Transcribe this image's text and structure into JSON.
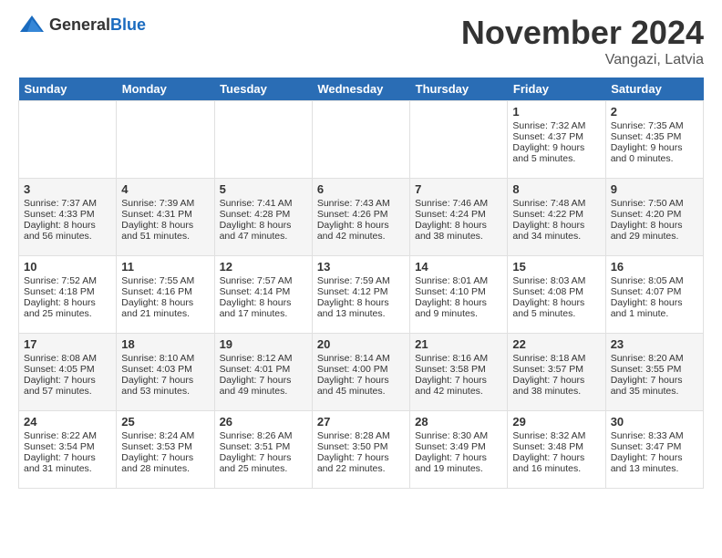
{
  "header": {
    "logo_general": "General",
    "logo_blue": "Blue",
    "month_title": "November 2024",
    "location": "Vangazi, Latvia"
  },
  "days_of_week": [
    "Sunday",
    "Monday",
    "Tuesday",
    "Wednesday",
    "Thursday",
    "Friday",
    "Saturday"
  ],
  "weeks": [
    [
      {
        "day": "",
        "sunrise": "",
        "sunset": "",
        "daylight": "",
        "empty": true
      },
      {
        "day": "",
        "sunrise": "",
        "sunset": "",
        "daylight": "",
        "empty": true
      },
      {
        "day": "",
        "sunrise": "",
        "sunset": "",
        "daylight": "",
        "empty": true
      },
      {
        "day": "",
        "sunrise": "",
        "sunset": "",
        "daylight": "",
        "empty": true
      },
      {
        "day": "",
        "sunrise": "",
        "sunset": "",
        "daylight": "",
        "empty": true
      },
      {
        "day": "1",
        "sunrise": "Sunrise: 7:32 AM",
        "sunset": "Sunset: 4:37 PM",
        "daylight": "Daylight: 9 hours and 5 minutes."
      },
      {
        "day": "2",
        "sunrise": "Sunrise: 7:35 AM",
        "sunset": "Sunset: 4:35 PM",
        "daylight": "Daylight: 9 hours and 0 minutes."
      }
    ],
    [
      {
        "day": "3",
        "sunrise": "Sunrise: 7:37 AM",
        "sunset": "Sunset: 4:33 PM",
        "daylight": "Daylight: 8 hours and 56 minutes."
      },
      {
        "day": "4",
        "sunrise": "Sunrise: 7:39 AM",
        "sunset": "Sunset: 4:31 PM",
        "daylight": "Daylight: 8 hours and 51 minutes."
      },
      {
        "day": "5",
        "sunrise": "Sunrise: 7:41 AM",
        "sunset": "Sunset: 4:28 PM",
        "daylight": "Daylight: 8 hours and 47 minutes."
      },
      {
        "day": "6",
        "sunrise": "Sunrise: 7:43 AM",
        "sunset": "Sunset: 4:26 PM",
        "daylight": "Daylight: 8 hours and 42 minutes."
      },
      {
        "day": "7",
        "sunrise": "Sunrise: 7:46 AM",
        "sunset": "Sunset: 4:24 PM",
        "daylight": "Daylight: 8 hours and 38 minutes."
      },
      {
        "day": "8",
        "sunrise": "Sunrise: 7:48 AM",
        "sunset": "Sunset: 4:22 PM",
        "daylight": "Daylight: 8 hours and 34 minutes."
      },
      {
        "day": "9",
        "sunrise": "Sunrise: 7:50 AM",
        "sunset": "Sunset: 4:20 PM",
        "daylight": "Daylight: 8 hours and 29 minutes."
      }
    ],
    [
      {
        "day": "10",
        "sunrise": "Sunrise: 7:52 AM",
        "sunset": "Sunset: 4:18 PM",
        "daylight": "Daylight: 8 hours and 25 minutes."
      },
      {
        "day": "11",
        "sunrise": "Sunrise: 7:55 AM",
        "sunset": "Sunset: 4:16 PM",
        "daylight": "Daylight: 8 hours and 21 minutes."
      },
      {
        "day": "12",
        "sunrise": "Sunrise: 7:57 AM",
        "sunset": "Sunset: 4:14 PM",
        "daylight": "Daylight: 8 hours and 17 minutes."
      },
      {
        "day": "13",
        "sunrise": "Sunrise: 7:59 AM",
        "sunset": "Sunset: 4:12 PM",
        "daylight": "Daylight: 8 hours and 13 minutes."
      },
      {
        "day": "14",
        "sunrise": "Sunrise: 8:01 AM",
        "sunset": "Sunset: 4:10 PM",
        "daylight": "Daylight: 8 hours and 9 minutes."
      },
      {
        "day": "15",
        "sunrise": "Sunrise: 8:03 AM",
        "sunset": "Sunset: 4:08 PM",
        "daylight": "Daylight: 8 hours and 5 minutes."
      },
      {
        "day": "16",
        "sunrise": "Sunrise: 8:05 AM",
        "sunset": "Sunset: 4:07 PM",
        "daylight": "Daylight: 8 hours and 1 minute."
      }
    ],
    [
      {
        "day": "17",
        "sunrise": "Sunrise: 8:08 AM",
        "sunset": "Sunset: 4:05 PM",
        "daylight": "Daylight: 7 hours and 57 minutes."
      },
      {
        "day": "18",
        "sunrise": "Sunrise: 8:10 AM",
        "sunset": "Sunset: 4:03 PM",
        "daylight": "Daylight: 7 hours and 53 minutes."
      },
      {
        "day": "19",
        "sunrise": "Sunrise: 8:12 AM",
        "sunset": "Sunset: 4:01 PM",
        "daylight": "Daylight: 7 hours and 49 minutes."
      },
      {
        "day": "20",
        "sunrise": "Sunrise: 8:14 AM",
        "sunset": "Sunset: 4:00 PM",
        "daylight": "Daylight: 7 hours and 45 minutes."
      },
      {
        "day": "21",
        "sunrise": "Sunrise: 8:16 AM",
        "sunset": "Sunset: 3:58 PM",
        "daylight": "Daylight: 7 hours and 42 minutes."
      },
      {
        "day": "22",
        "sunrise": "Sunrise: 8:18 AM",
        "sunset": "Sunset: 3:57 PM",
        "daylight": "Daylight: 7 hours and 38 minutes."
      },
      {
        "day": "23",
        "sunrise": "Sunrise: 8:20 AM",
        "sunset": "Sunset: 3:55 PM",
        "daylight": "Daylight: 7 hours and 35 minutes."
      }
    ],
    [
      {
        "day": "24",
        "sunrise": "Sunrise: 8:22 AM",
        "sunset": "Sunset: 3:54 PM",
        "daylight": "Daylight: 7 hours and 31 minutes."
      },
      {
        "day": "25",
        "sunrise": "Sunrise: 8:24 AM",
        "sunset": "Sunset: 3:53 PM",
        "daylight": "Daylight: 7 hours and 28 minutes."
      },
      {
        "day": "26",
        "sunrise": "Sunrise: 8:26 AM",
        "sunset": "Sunset: 3:51 PM",
        "daylight": "Daylight: 7 hours and 25 minutes."
      },
      {
        "day": "27",
        "sunrise": "Sunrise: 8:28 AM",
        "sunset": "Sunset: 3:50 PM",
        "daylight": "Daylight: 7 hours and 22 minutes."
      },
      {
        "day": "28",
        "sunrise": "Sunrise: 8:30 AM",
        "sunset": "Sunset: 3:49 PM",
        "daylight": "Daylight: 7 hours and 19 minutes."
      },
      {
        "day": "29",
        "sunrise": "Sunrise: 8:32 AM",
        "sunset": "Sunset: 3:48 PM",
        "daylight": "Daylight: 7 hours and 16 minutes."
      },
      {
        "day": "30",
        "sunrise": "Sunrise: 8:33 AM",
        "sunset": "Sunset: 3:47 PM",
        "daylight": "Daylight: 7 hours and 13 minutes."
      }
    ]
  ]
}
